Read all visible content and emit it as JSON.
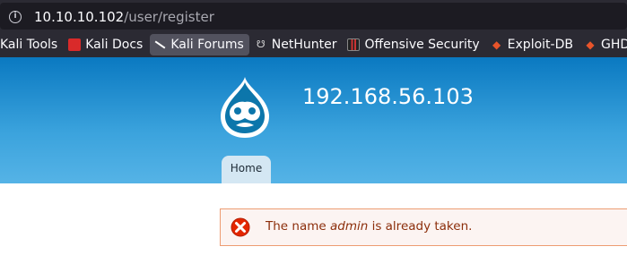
{
  "browser": {
    "url_host": "10.10.10.102",
    "url_path": "/user/register",
    "bookmarks": [
      {
        "label": "Kali Tools",
        "icon": "none"
      },
      {
        "label": "Kali Docs",
        "icon": "kali-docs-icon"
      },
      {
        "label": "Kali Forums",
        "icon": "kali-forums-icon"
      },
      {
        "label": "NetHunter",
        "icon": "nethunter-icon"
      },
      {
        "label": "Offensive Security",
        "icon": "offensive-security-icon"
      },
      {
        "label": "Exploit-DB",
        "icon": "exploit-db-icon"
      },
      {
        "label": "GHDB",
        "icon": "ghdb-icon"
      }
    ]
  },
  "site": {
    "name": "192.168.56.103",
    "tabs": [
      {
        "label": "Home"
      }
    ]
  },
  "message": {
    "prefix": "The name ",
    "name": "admin",
    "suffix": " is already taken."
  },
  "colors": {
    "header_top": "#0a79c1",
    "header_bottom": "#55b3e6",
    "error_text": "#8c2e0b",
    "error_border": "#ed9c72",
    "error_bg": "#fcf4f2"
  }
}
